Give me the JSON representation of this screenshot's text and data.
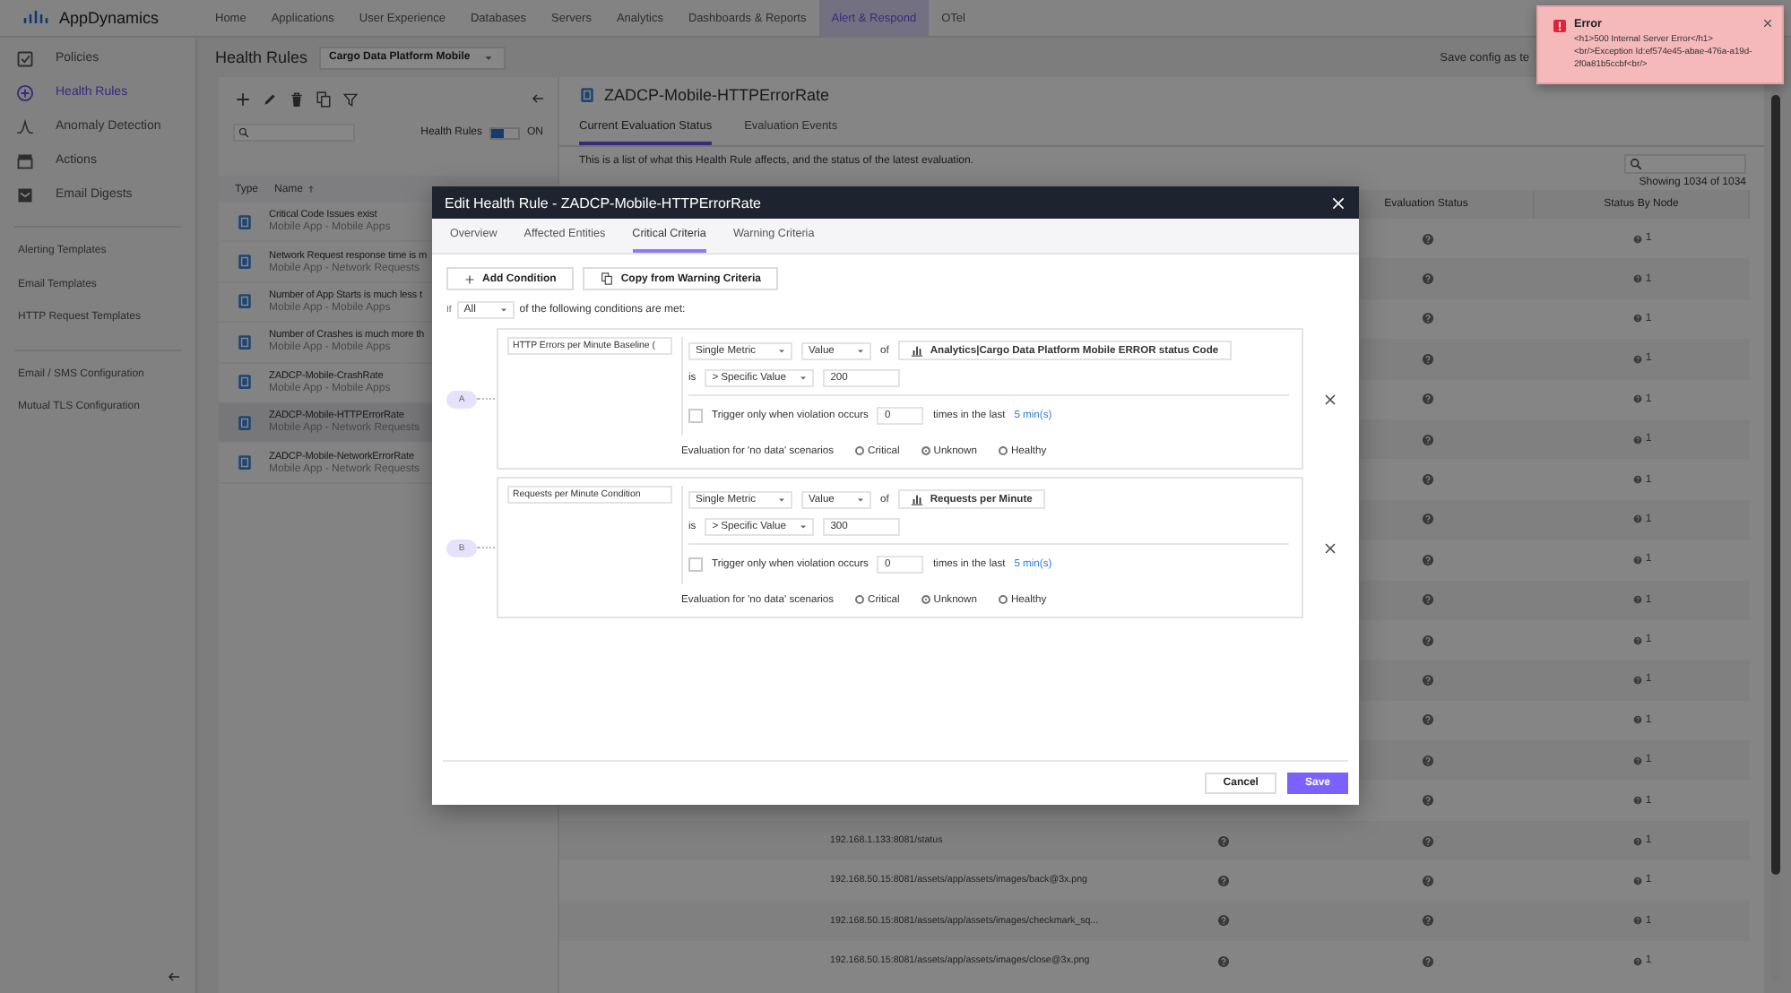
{
  "top_bar": {
    "brand": "AppDynamics",
    "nav": [
      {
        "label": "Home",
        "selected": false
      },
      {
        "label": "Applications",
        "selected": false
      },
      {
        "label": "User Experience",
        "selected": false
      },
      {
        "label": "Databases",
        "selected": false
      },
      {
        "label": "Servers",
        "selected": false
      },
      {
        "label": "Analytics",
        "selected": false
      },
      {
        "label": "Dashboards & Reports",
        "selected": false
      },
      {
        "label": "Alert & Respond",
        "selected": true
      },
      {
        "label": "OTel",
        "selected": false
      }
    ]
  },
  "sidebar": {
    "items": [
      {
        "label": "Policies",
        "selected": false
      },
      {
        "label": "Health Rules",
        "selected": true
      },
      {
        "label": "Anomaly Detection",
        "selected": false
      },
      {
        "label": "Actions",
        "selected": false
      },
      {
        "label": "Email Digests",
        "selected": false
      }
    ],
    "link_groups": [
      {
        "links": [
          "Alerting Templates",
          "Email Templates",
          "HTTP Request Templates"
        ]
      },
      {
        "links": [
          "Email / SMS Configuration",
          "Mutual TLS Configuration"
        ]
      }
    ]
  },
  "page_header": {
    "title": "Health Rules",
    "application": "Cargo Data Platform Mobile",
    "save_config": "Save config as te"
  },
  "rules_panel": {
    "toggle": {
      "label": "Health Rules",
      "on": true,
      "state_text": "ON"
    },
    "columns": [
      {
        "label": "Type",
        "sorted": false
      },
      {
        "label": "Name",
        "sorted": true
      }
    ],
    "rules": [
      {
        "name": "Critical Code Issues exist",
        "scope": "Mobile App - Mobile Apps",
        "selected": false
      },
      {
        "name": "Network Request response time is m",
        "scope": "Mobile App - Network Requests",
        "selected": false
      },
      {
        "name": "Number of App Starts is much less t",
        "scope": "Mobile App - Mobile Apps",
        "selected": false
      },
      {
        "name": "Number of Crashes is much more th",
        "scope": "Mobile App - Mobile Apps",
        "selected": false
      },
      {
        "name": "ZADCP-Mobile-CrashRate",
        "scope": "Mobile App - Mobile Apps",
        "selected": false
      },
      {
        "name": "ZADCP-Mobile-HTTPErrorRate",
        "scope": "Mobile App - Network Requests",
        "selected": true
      },
      {
        "name": "ZADCP-Mobile-NetworkErrorRate",
        "scope": "Mobile App - Network Requests",
        "selected": false
      }
    ]
  },
  "detail_panel": {
    "title": "ZADCP-Mobile-HTTPErrorRate",
    "tabs": [
      {
        "label": "Current Evaluation Status",
        "selected": true
      },
      {
        "label": "Evaluation Events",
        "selected": false
      }
    ],
    "description": "This is a list of what this Health Rule affects, and the status of the latest evaluation.",
    "count": "Showing 1034 of 1034",
    "columns": [
      "Evaluation Status",
      "Status By Node"
    ],
    "rows": [
      {
        "nodes": "1"
      },
      {
        "nodes": "1"
      },
      {
        "nodes": "1"
      },
      {
        "nodes": "1"
      },
      {
        "nodes": "1"
      },
      {
        "nodes": "1"
      },
      {
        "nodes": "1"
      },
      {
        "nodes": "1"
      },
      {
        "nodes": "1"
      },
      {
        "nodes": "1"
      },
      {
        "nodes": "1"
      },
      {
        "nodes": "1"
      },
      {
        "nodes": "1"
      },
      {
        "nodes": "1"
      },
      {
        "nodes": "1"
      },
      {
        "entity": "192.168.1.133:8081/status",
        "nodes": "1"
      },
      {
        "entity": "192.168.50.15:8081/assets/app/assets/images/back@3x.png",
        "nodes": "1"
      },
      {
        "entity": "192.168.50.15:8081/assets/app/assets/images/checkmark_sq...",
        "nodes": "1"
      },
      {
        "entity": "192.168.50.15:8081/assets/app/assets/images/close@3x.png",
        "nodes": "1"
      }
    ]
  },
  "modal": {
    "title": "Edit Health Rule - ZADCP-Mobile-HTTPErrorRate",
    "tabs": [
      {
        "label": "Overview",
        "selected": false
      },
      {
        "label": "Affected Entities",
        "selected": false
      },
      {
        "label": "Critical Criteria",
        "selected": true
      },
      {
        "label": "Warning Criteria",
        "selected": false
      }
    ],
    "add_condition": "Add Condition",
    "copy_criteria": "Copy from Warning Criteria",
    "if_label": "If",
    "match": "All",
    "match_text": "of the following conditions are met:",
    "conditions": [
      {
        "label": "A",
        "name": "HTTP Errors per Minute Baseline (",
        "metric_type": "Single Metric",
        "value_type": "Value",
        "of": "of",
        "metric": "Analytics|Cargo Data Platform Mobile ERROR status Code",
        "is": "is",
        "comparison": "> Specific Value",
        "threshold": "200",
        "trigger_checked": false,
        "trigger_text": "Trigger only when violation occurs",
        "trigger_count": "0",
        "times_text": "times in the last",
        "window": "5 min(s)",
        "no_data_text": "Evaluation for 'no data' scenarios",
        "no_data_options": [
          {
            "label": "Critical",
            "selected": false
          },
          {
            "label": "Unknown",
            "selected": true
          },
          {
            "label": "Healthy",
            "selected": false
          }
        ]
      },
      {
        "label": "B",
        "name": "Requests per Minute Condition",
        "metric_type": "Single Metric",
        "value_type": "Value",
        "of": "of",
        "metric": "Requests per Minute",
        "is": "is",
        "comparison": "> Specific Value",
        "threshold": "300",
        "trigger_checked": false,
        "trigger_text": "Trigger only when violation occurs",
        "trigger_count": "0",
        "times_text": "times in the last",
        "window": "5 min(s)",
        "no_data_text": "Evaluation for 'no data' scenarios",
        "no_data_options": [
          {
            "label": "Critical",
            "selected": false
          },
          {
            "label": "Unknown",
            "selected": true
          },
          {
            "label": "Healthy",
            "selected": false
          }
        ]
      }
    ],
    "cancel": "Cancel",
    "save": "Save"
  },
  "toast": {
    "title": "Error",
    "message": "<h1>500 Internal Server Error</h1> <br/>Exception Id:ef574e45-abae-476a-a19d-2f0a81b5ccbf<br/>"
  }
}
